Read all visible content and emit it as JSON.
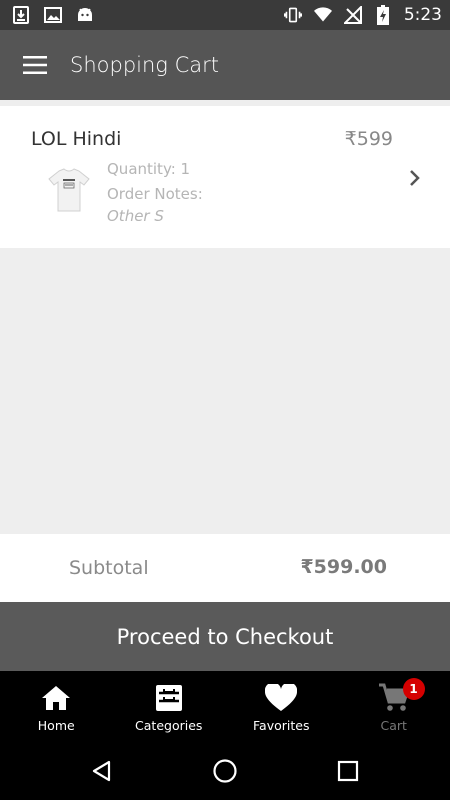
{
  "status_bar": {
    "time": "5:23",
    "left_icons": [
      "download-icon",
      "image-icon",
      "android-icon"
    ],
    "right_icons": [
      "vibrate-icon",
      "wifi-icon",
      "no-signal-icon",
      "battery-charging-icon"
    ]
  },
  "app_bar": {
    "title": "Shopping Cart",
    "menu_icon": "hamburger-menu-icon"
  },
  "cart": {
    "items": [
      {
        "name": "LOL Hindi",
        "price": "₹599",
        "quantity": "Quantity: 1",
        "notes_label": "Order Notes:",
        "notes_value": "Other S",
        "image_icon": "tshirt-icon"
      }
    ]
  },
  "subtotal": {
    "label": "Subtotal",
    "value": "₹599.00"
  },
  "checkout": {
    "label": "Proceed to Checkout"
  },
  "bottom_nav": {
    "items": [
      {
        "label": "Home",
        "icon": "home-icon",
        "active": true
      },
      {
        "label": "Categories",
        "icon": "categories-icon",
        "active": true
      },
      {
        "label": "Favorites",
        "icon": "heart-icon",
        "active": true
      },
      {
        "label": "Cart",
        "icon": "cart-icon",
        "active": false,
        "badge": "1"
      }
    ]
  },
  "system_nav": {
    "icons": [
      "back-icon",
      "home-circle-icon",
      "recents-icon"
    ]
  },
  "colors": {
    "app_bar": "#555555",
    "status_bar": "#3a3a3a",
    "checkout": "#5a5a5a",
    "badge": "#d50000",
    "background": "#eeeeee"
  }
}
